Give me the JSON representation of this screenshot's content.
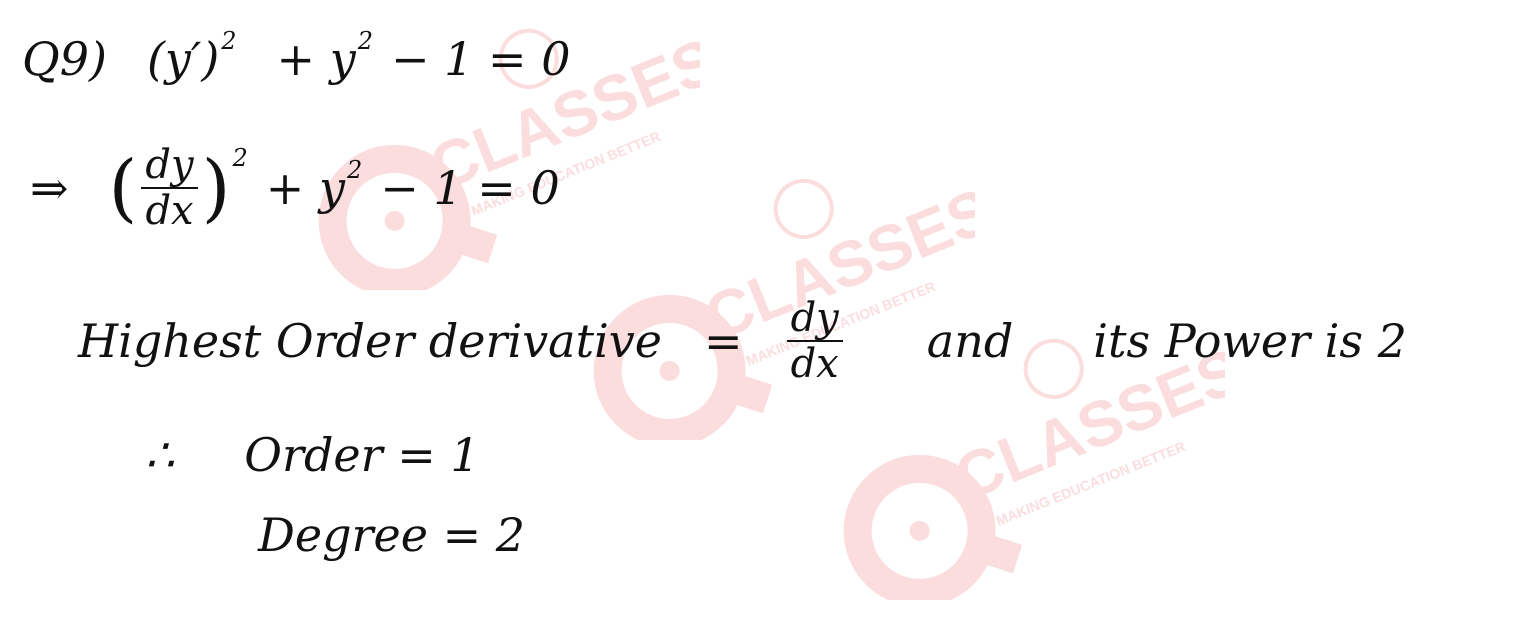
{
  "question": {
    "label": "Q9)",
    "equation": [
      "(y′)",
      "2",
      "+ y",
      "2",
      "− 1  = 0"
    ]
  },
  "step": {
    "implies": "⇒",
    "num": "dy",
    "den": "dx",
    "power": "2",
    "rest": [
      "+ y",
      "2",
      "− 1  = 0"
    ]
  },
  "statement": {
    "text_start": "Highest Order derivative",
    "equals": "=",
    "num": "dy",
    "den": "dx",
    "text_mid": "and",
    "text_end": "its Power is 2"
  },
  "result": {
    "therefore": "∴",
    "order_text": "Order = 1",
    "degree_text": "Degree = 2"
  },
  "watermark": {
    "brand": "CLASSES",
    "tagline": "MAKING EDUCATION BETTER",
    "color": "#e8323a"
  }
}
